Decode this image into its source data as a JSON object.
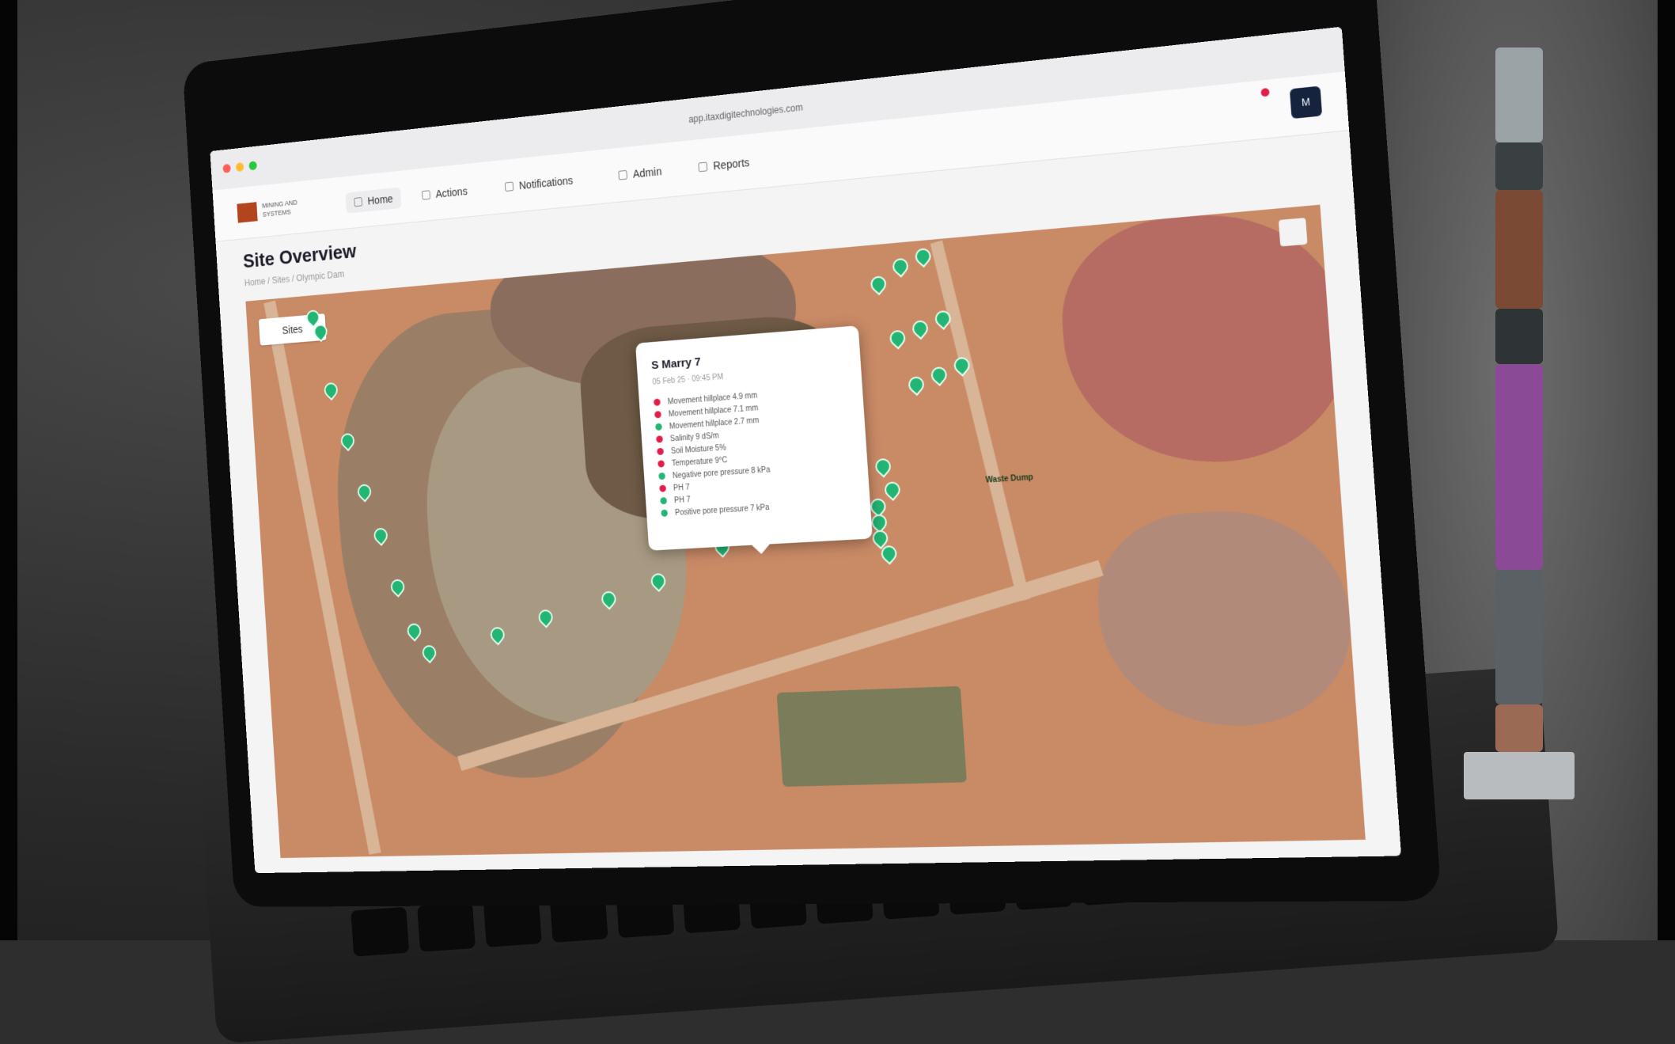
{
  "browser": {
    "url": "app.itaxdigitechnologies.com"
  },
  "app": {
    "logo_text": "MINING AND SYSTEMS",
    "nav": [
      {
        "label": "Home",
        "active": true
      },
      {
        "label": "Actions",
        "active": false
      },
      {
        "label": "Notifications",
        "active": false
      },
      {
        "label": "Admin",
        "active": false
      },
      {
        "label": "Reports",
        "active": false
      }
    ],
    "avatar_initial": "M",
    "page_title": "Site Overview",
    "breadcrumb": "Home  /  Sites  /  Olympic Dam"
  },
  "map": {
    "sites_button": "Sites",
    "popup": {
      "title": "S Marry 7",
      "subtitle": "05 Feb 25 · 09:45 PM",
      "readings": [
        {
          "label": "Movement hillplace 4.9 mm",
          "status": "alert",
          "color": "#e11d48"
        },
        {
          "label": "Movement hillplace 7.1 mm",
          "status": "alert",
          "color": "#e11d48"
        },
        {
          "label": "Movement hillplace 2.7 mm",
          "status": "ok",
          "color": "#22b573"
        },
        {
          "label": "Salinity 9 dS/m",
          "status": "alert",
          "color": "#e11d48"
        },
        {
          "label": "Soil Moisture 5%",
          "status": "alert",
          "color": "#e11d48"
        },
        {
          "label": "Temperature 9°C",
          "status": "alert",
          "color": "#e11d48"
        },
        {
          "label": "Negative pore pressure 8 kPa",
          "status": "ok",
          "color": "#22b573"
        },
        {
          "label": "PH 7",
          "status": "alert",
          "color": "#e11d48"
        },
        {
          "label": "PH 7",
          "status": "ok",
          "color": "#22b573"
        },
        {
          "label": "Positive pore pressure 7 kPa",
          "status": "ok",
          "color": "#22b573"
        }
      ]
    },
    "map_label": "Waste Dump",
    "marker_color": "#22b573"
  }
}
